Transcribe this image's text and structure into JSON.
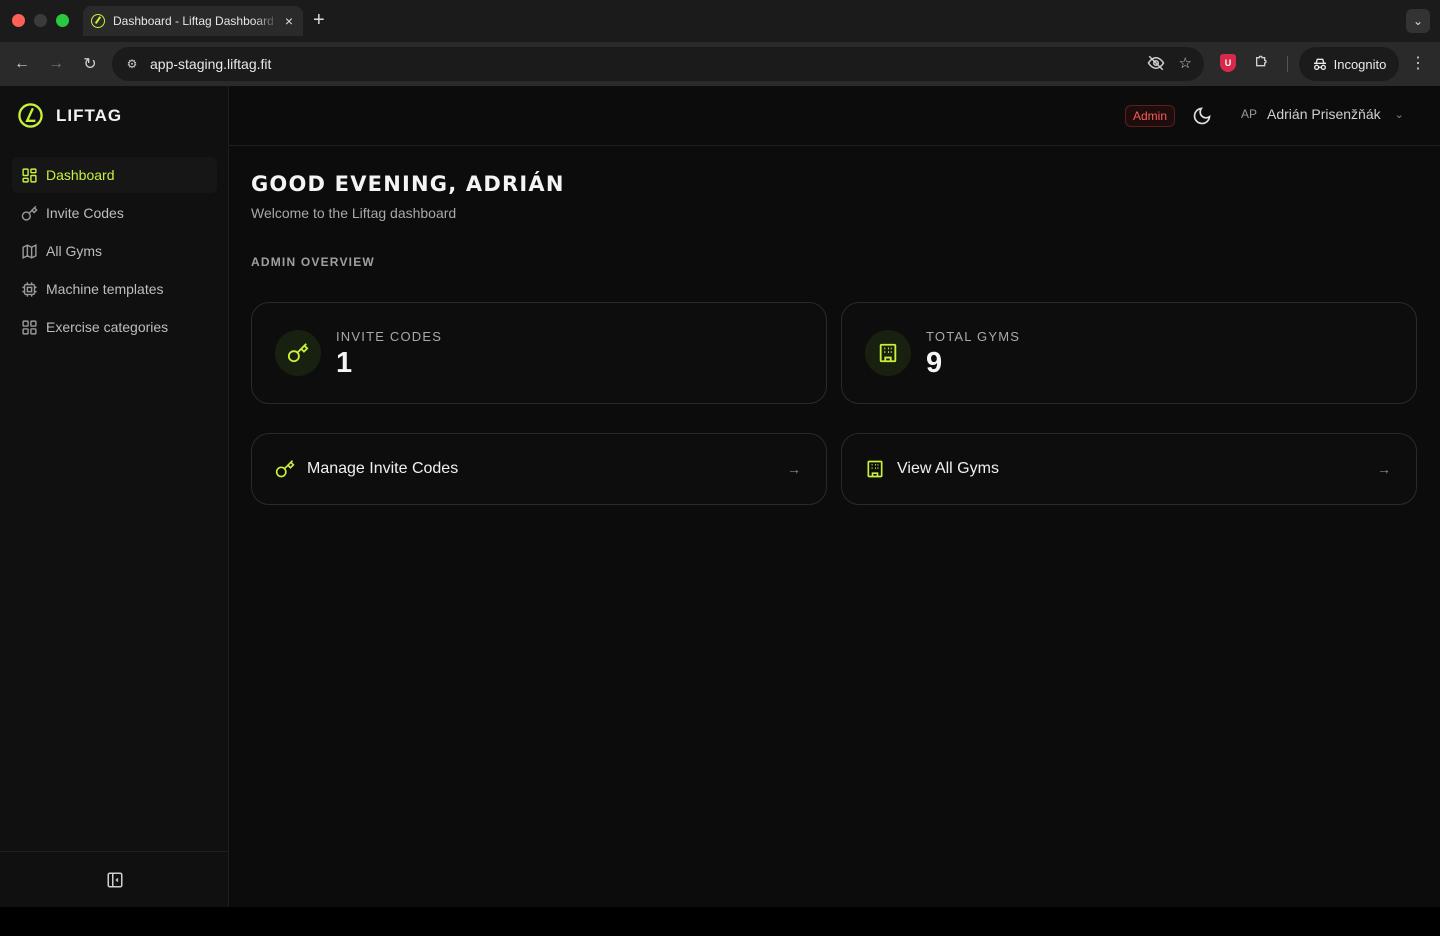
{
  "browser": {
    "tab_title": "Dashboard - Liftag Dashboard",
    "tab_close": "×",
    "new_tab": "+",
    "url": "app-staging.liftag.fit",
    "extension_badge": "U",
    "profile_label": "Incognito"
  },
  "brand": {
    "name": "LIFTAG",
    "accent_color": "#c8f03c"
  },
  "sidebar": {
    "items": [
      {
        "label": "Dashboard",
        "icon": "layout-grid-icon",
        "active": true
      },
      {
        "label": "Invite Codes",
        "icon": "key-icon",
        "active": false
      },
      {
        "label": "All Gyms",
        "icon": "map-icon",
        "active": false
      },
      {
        "label": "Machine templates",
        "icon": "cpu-icon",
        "active": false
      },
      {
        "label": "Exercise categories",
        "icon": "grid-icon",
        "active": false
      }
    ],
    "collapse_icon": "sidebar-collapse-icon"
  },
  "header": {
    "role_badge": "Admin",
    "role_badge_color": "#ff5a5a",
    "theme_icon": "moon-icon",
    "user_initials": "AP",
    "user_name": "Adrián Prisenžňák"
  },
  "main": {
    "greeting": "GOOD EVENING, ADRIÁN",
    "subtitle": "Welcome to the Liftag dashboard",
    "section_label": "ADMIN OVERVIEW",
    "stats": [
      {
        "label": "INVITE CODES",
        "value": "1",
        "icon": "key-icon"
      },
      {
        "label": "TOTAL GYMS",
        "value": "9",
        "icon": "building-icon"
      }
    ],
    "actions": [
      {
        "label": "Manage Invite Codes",
        "icon": "key-icon",
        "arrow": "→"
      },
      {
        "label": "View All Gyms",
        "icon": "building-icon",
        "arrow": "→"
      }
    ]
  }
}
